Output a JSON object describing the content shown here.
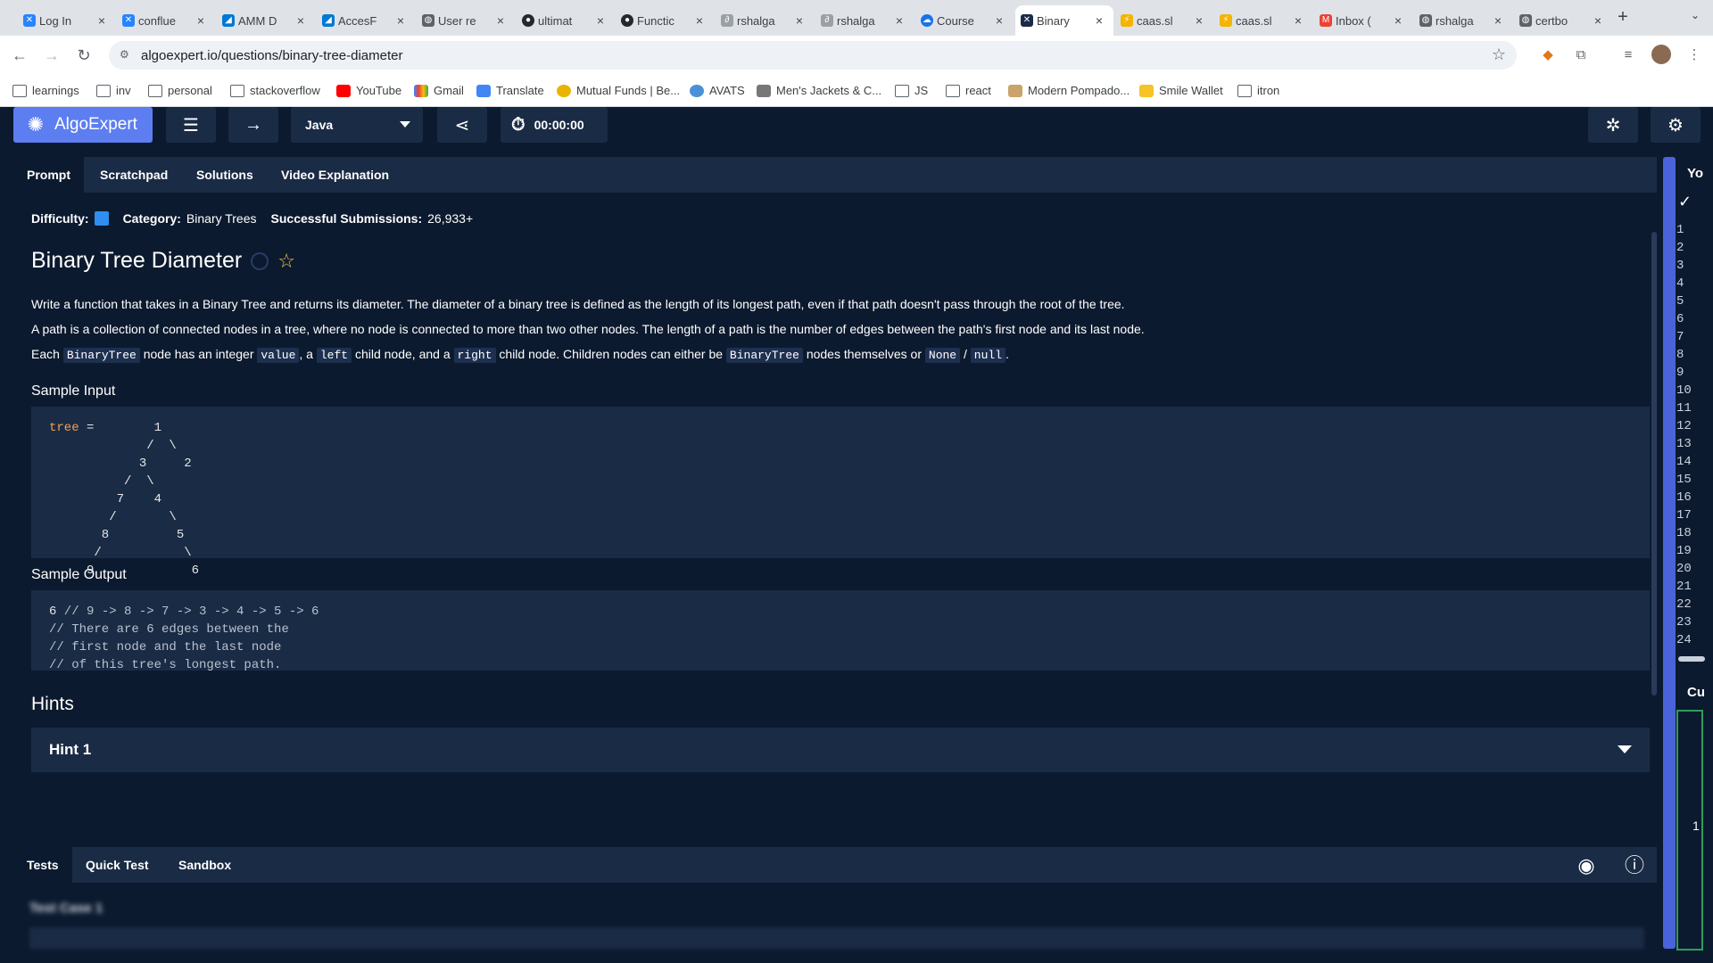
{
  "browser": {
    "tabs": [
      {
        "label": "Log In",
        "icon": "confluence-icon",
        "color": "#2684ff"
      },
      {
        "label": "conflue",
        "icon": "confluence-icon",
        "color": "#2684ff"
      },
      {
        "label": "AMM D",
        "icon": "azure-devops-icon",
        "color": "#0078d4"
      },
      {
        "label": "AccesF",
        "icon": "azure-devops-icon",
        "color": "#0078d4"
      },
      {
        "label": "User re",
        "icon": "globe-icon",
        "color": "#5f6368"
      },
      {
        "label": "ultimat",
        "icon": "github-icon",
        "color": "#24292e"
      },
      {
        "label": "Functic",
        "icon": "github-icon",
        "color": "#24292e"
      },
      {
        "label": "rshalga",
        "icon": "link-icon",
        "color": "#7a7a7a"
      },
      {
        "label": "rshalga",
        "icon": "link-icon",
        "color": "#7a7a7a"
      },
      {
        "label": "Course",
        "icon": "cloud-icon",
        "color": "#1a73e8"
      },
      {
        "label": "Binary",
        "icon": "algoexpert-icon",
        "color": "#1a2b45"
      },
      {
        "label": "caas.sl",
        "icon": "bolt-icon",
        "color": "#f4b400"
      },
      {
        "label": "caas.sl",
        "icon": "bolt-icon",
        "color": "#f4b400"
      },
      {
        "label": "Inbox (",
        "icon": "gmail-icon",
        "color": "#ea4335"
      },
      {
        "label": "rshalga",
        "icon": "globe-icon",
        "color": "#5f6368"
      },
      {
        "label": "certbo",
        "icon": "globe-icon",
        "color": "#5f6368"
      }
    ],
    "active_tab_index": 10,
    "url": "algoexpert.io/questions/binary-tree-diameter",
    "bookmarks": [
      {
        "label": "learnings",
        "icon": "folder-icon"
      },
      {
        "label": "inv",
        "icon": "folder-icon"
      },
      {
        "label": "personal",
        "icon": "folder-icon"
      },
      {
        "label": "stackoverflow",
        "icon": "folder-icon"
      },
      {
        "label": "YouTube",
        "icon": "youtube-icon"
      },
      {
        "label": "Gmail",
        "icon": "google-icon"
      },
      {
        "label": "Translate",
        "icon": "translate-icon"
      },
      {
        "label": "Mutual Funds | Be...",
        "icon": "mutual-funds-icon"
      },
      {
        "label": "AVATS",
        "icon": "avats-icon"
      },
      {
        "label": "Men's Jackets & C...",
        "icon": "store-icon"
      },
      {
        "label": "JS",
        "icon": "folder-icon"
      },
      {
        "label": "react",
        "icon": "folder-icon"
      },
      {
        "label": "Modern Pompado...",
        "icon": "barber-icon"
      },
      {
        "label": "Smile Wallet",
        "icon": "wallet-icon"
      },
      {
        "label": "itron",
        "icon": "folder-icon"
      }
    ]
  },
  "app": {
    "logo_text": "AlgoExpert",
    "language": "Java",
    "timer": "00:00:00",
    "colors": {
      "brand": "#5d7ef0",
      "bg": "#0c1a2f",
      "panel": "#1a2b45",
      "difficulty": "#2f8ef0"
    }
  },
  "prompt_tabs": [
    "Prompt",
    "Scratchpad",
    "Solutions",
    "Video Explanation"
  ],
  "question": {
    "difficulty_label": "Difficulty:",
    "category_label": "Category:",
    "category": "Binary Trees",
    "submissions_label": "Successful Submissions:",
    "submissions": "26,933+",
    "title": "Binary Tree Diameter",
    "p1": "Write a function that takes in a Binary Tree and returns its diameter. The diameter of a binary tree is defined as the length of its longest path, even if that path doesn't pass through the root of the tree.",
    "p2": "A path is a collection of connected nodes in a tree, where no node is connected to more than two other nodes. The length of a path is the number of edges between the path's first node and its last node.",
    "p3": {
      "t1": "Each ",
      "c1": "BinaryTree",
      "t2": " node has an integer ",
      "c2": "value",
      "t3": ", a ",
      "c3": "left",
      "t4": " child node, and a ",
      "c4": "right",
      "t5": " child node. Children nodes can either be ",
      "c5": "BinaryTree",
      "t6": " nodes themselves or ",
      "c6": "None",
      "t7": " / ",
      "c7": "null",
      "t8": "."
    },
    "sample_input_label": "Sample Input",
    "sample_input_kw": "tree",
    "sample_input_body": " =        1\n             /  \\\n            3     2\n          /  \\\n         7    4\n        /       \\\n       8         5\n      /           \\\n     9             6",
    "sample_output_label": "Sample Output",
    "sample_output_value": "6",
    "sample_output_comment": " // 9 -> 8 -> 7 -> 3 -> 4 -> 5 -> 6\n// There are 6 edges between the\n// first node and the last node\n// of this tree's longest path.",
    "hints_label": "Hints",
    "hint1_label": "Hint 1"
  },
  "tests": {
    "tabs": [
      "Tests",
      "Quick Test",
      "Sandbox"
    ],
    "test_case_label": "Test Case 1"
  },
  "editor": {
    "title_partial": "Yo",
    "custom_partial": "Cu",
    "line_numbers": [
      "1",
      "2",
      "3",
      "4",
      "5",
      "6",
      "7",
      "8",
      "9",
      "10",
      "11",
      "12",
      "13",
      "14",
      "15",
      "16",
      "17",
      "18",
      "19",
      "20",
      "21",
      "22",
      "23",
      "24"
    ],
    "green_box_number": "1"
  }
}
